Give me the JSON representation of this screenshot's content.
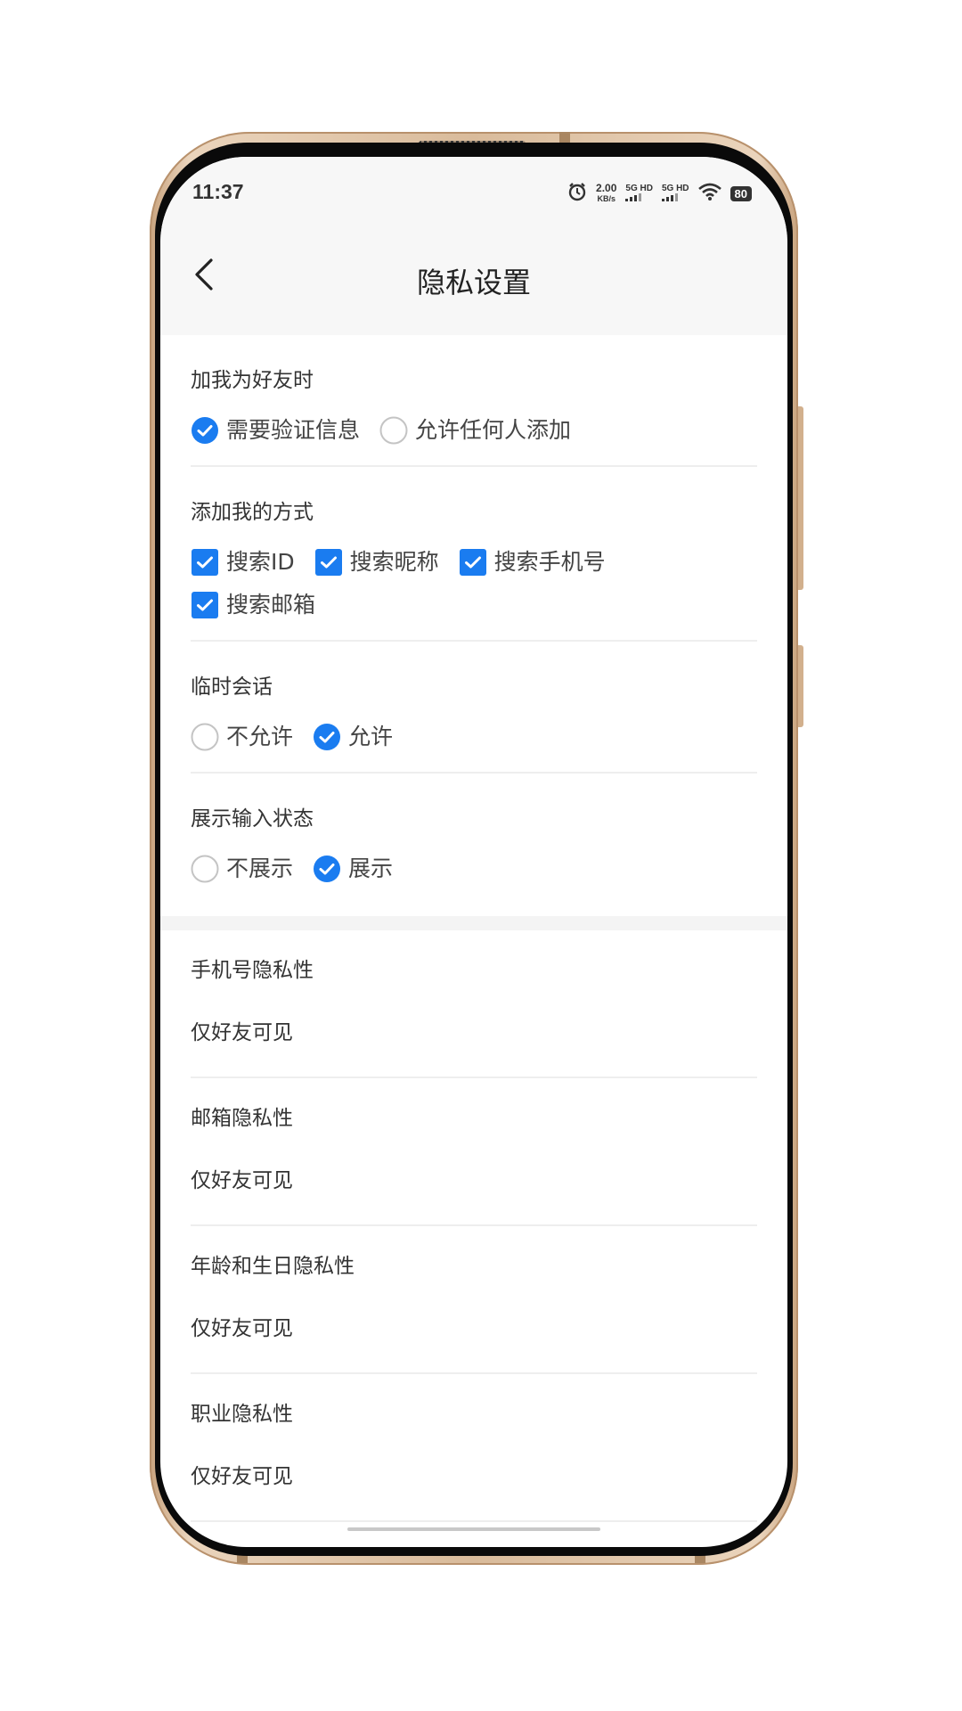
{
  "status_bar": {
    "time": "11:37",
    "speed_value": "2.00",
    "speed_unit": "KB/s",
    "sig1": "5G HD",
    "sig2": "5G HD",
    "battery": "80"
  },
  "header": {
    "title": "隐私设置"
  },
  "groups": [
    {
      "title": "加我为好友时",
      "type": "radio",
      "options": [
        {
          "label": "需要验证信息",
          "checked": true
        },
        {
          "label": "允许任何人添加",
          "checked": false
        }
      ]
    },
    {
      "title": "添加我的方式",
      "type": "checkbox",
      "options": [
        {
          "label": "搜索ID",
          "checked": true
        },
        {
          "label": "搜索昵称",
          "checked": true
        },
        {
          "label": "搜索手机号",
          "checked": true
        },
        {
          "label": "搜索邮箱",
          "checked": true
        }
      ]
    },
    {
      "title": "临时会话",
      "type": "radio",
      "options": [
        {
          "label": "不允许",
          "checked": false
        },
        {
          "label": "允许",
          "checked": true
        }
      ]
    },
    {
      "title": "展示输入状态",
      "type": "radio",
      "options": [
        {
          "label": "不展示",
          "checked": false
        },
        {
          "label": "展示",
          "checked": true
        }
      ]
    }
  ],
  "privacy": [
    {
      "label": "手机号隐私性",
      "value": "仅好友可见"
    },
    {
      "label": "邮箱隐私性",
      "value": "仅好友可见"
    },
    {
      "label": "年龄和生日隐私性",
      "value": "仅好友可见"
    },
    {
      "label": "职业隐私性",
      "value": "仅好友可见"
    }
  ],
  "colors": {
    "accent": "#1a7cf0",
    "unchecked_border": "#c4c4c4"
  }
}
